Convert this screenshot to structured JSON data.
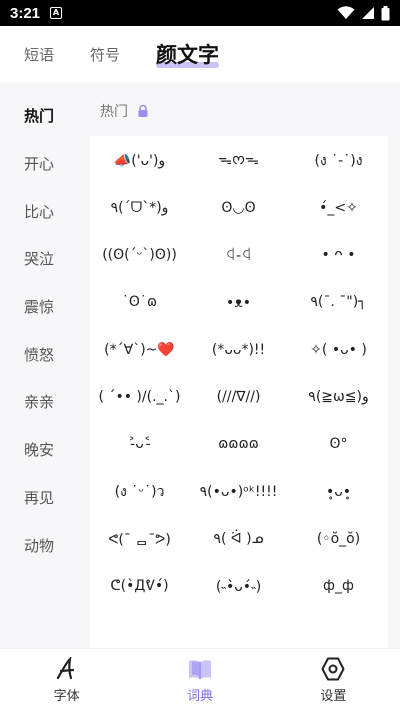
{
  "status": {
    "time": "3:21",
    "notif_letter": "A"
  },
  "tabs": [
    {
      "label": "短语"
    },
    {
      "label": "符号"
    },
    {
      "label": "颜文字"
    }
  ],
  "sidebar": {
    "items": [
      {
        "label": "热门"
      },
      {
        "label": "开心"
      },
      {
        "label": "比心"
      },
      {
        "label": "哭泣"
      },
      {
        "label": "震惊"
      },
      {
        "label": "愤怒"
      },
      {
        "label": "亲亲"
      },
      {
        "label": "晚安"
      },
      {
        "label": "再见"
      },
      {
        "label": "动物"
      }
    ]
  },
  "section": {
    "title": "热门"
  },
  "kaomoji": [
    "📣('ᴗ')و",
    "ᯓᰔᯓ",
    "(ง ˙-˙)ง",
    "٩(ˊᗜˋ*)و",
    "ʘ◡ʘ",
    "•́_<✧",
    "((ʘ(ˊᵕˋ)ʘ))",
    "ꒉ-ꒉ",
    "• ᴖ •",
    "˙ʘ˙ɷ",
    "•ᴥ•",
    "٩(¯. ¯\")┐",
    "(*´∀`)~❤️",
    "(*ᴗᴗ*)!!",
    "✧( •ᴗ• )",
    "( ´•• )/(._.`)",
    "(///∇//)",
    "٩(≧ω≦)و",
    "˃̵ᴗ˂̵",
    "ɷɷɷɷ",
    "ʘ°",
    "(ง ˙ᵕ˙)ว",
    "٩(•ᴗ•)ᵒᵏ!!!!",
    "•̥ᴗ•̥",
    "ᕙ(¯ ᆷ¯ᕗ)",
    "٩( ᐛ )ᓄ",
    "(◦ŏ_ŏ)",
    "ᕦ(•̀Дᕓ•́)",
    "(˵•̀ᴗ•́˵)",
    "ф_ф"
  ],
  "bottom_nav": [
    {
      "label": "字体",
      "icon": "font-a-icon"
    },
    {
      "label": "词典",
      "icon": "book-icon"
    },
    {
      "label": "设置",
      "icon": "settings-hex-icon"
    }
  ],
  "colors": {
    "accent": "#7b6cf0",
    "tab_underline": "#c9c4f5",
    "background": "#f7f7f9"
  }
}
